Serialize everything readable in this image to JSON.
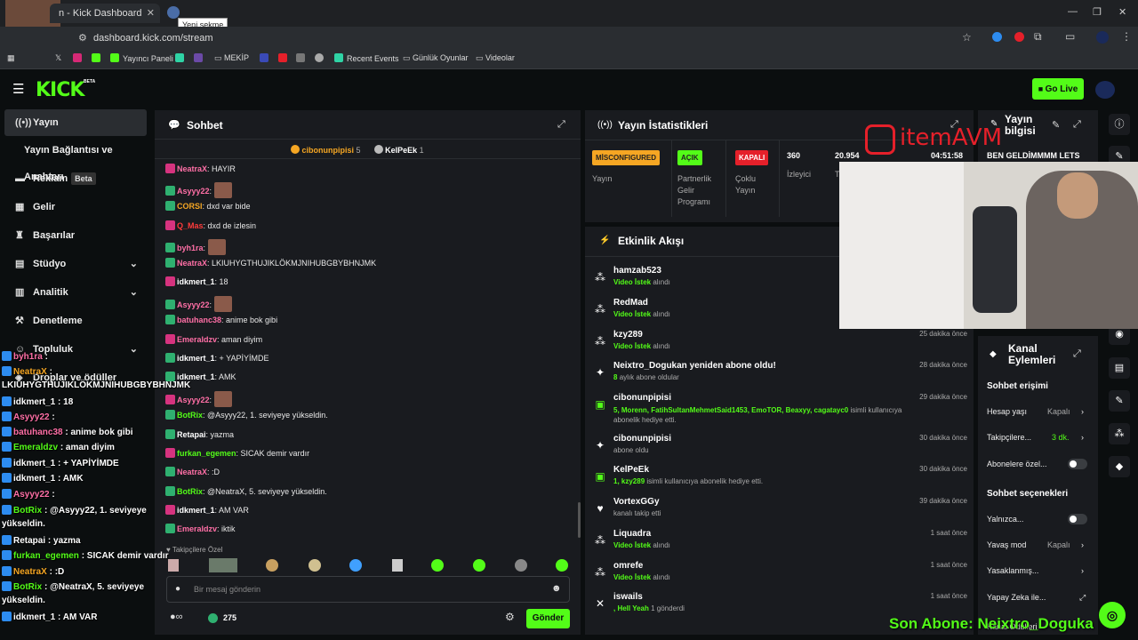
{
  "browser": {
    "tab_title": "n - Kick Dashboard",
    "tooltip": "Yeni sekme",
    "url": "dashboard.kick.com/stream",
    "bookmarks": [
      {
        "label": "Yayıncı Paneli",
        "color": "#53fc18"
      },
      {
        "label": "MEKİP",
        "color": "#888"
      },
      {
        "label": "Recent Events",
        "color": "#2fd3a5"
      },
      {
        "label": "Günlük Oyunlar",
        "color": "#888"
      },
      {
        "label": "Videolar",
        "color": "#888"
      }
    ]
  },
  "header": {
    "logo": "KICK",
    "logo_beta": "BETA",
    "go_live": "Go Live"
  },
  "sidebar": {
    "items": [
      {
        "label": "Yayın",
        "icon": "broadcast-icon"
      },
      {
        "label": "Yayın Bağlantısı ve Anahtarı"
      },
      {
        "label": "Reklam",
        "badge": "Beta",
        "icon": "ad-icon"
      },
      {
        "label": "Gelir",
        "icon": "revenue-icon"
      },
      {
        "label": "Başarılar",
        "icon": "trophy-icon"
      },
      {
        "label": "Stüdyo",
        "icon": "studio-icon"
      },
      {
        "label": "Analitik",
        "icon": "analytics-icon"
      },
      {
        "label": "Denetleme",
        "icon": "moderation-icon"
      },
      {
        "label": "Topluluk",
        "icon": "community-icon"
      },
      {
        "label": "Droplar ve ödüller",
        "icon": "drops-icon"
      }
    ]
  },
  "chat": {
    "title": "Sohbet",
    "top_gifters": [
      {
        "name": "cibonunpipisi",
        "count": "5"
      },
      {
        "name": "KelPeEk",
        "count": "1"
      }
    ],
    "messages": [
      {
        "user": "NeatraX",
        "color": "#ff6fa6",
        "text": "HAYIR"
      },
      {
        "user": "Asyyy22",
        "color": "#ff6fa6",
        "text": ""
      },
      {
        "user": "CORSI",
        "color": "#f5a623",
        "text": "dxd var bide"
      },
      {
        "user": "Q_Mas",
        "color": "#ff3b3b",
        "text": "dxd de izlesin"
      },
      {
        "user": "byh1ra",
        "color": "#ff6fa6",
        "text": ""
      },
      {
        "user": "NeatraX",
        "color": "#ff6fa6",
        "text": "LKIUHYGTHUJIKLÖKMJNIHUBGBYBHNJMK"
      },
      {
        "user": "idkmert_1",
        "color": "#ffffff",
        "text": "18"
      },
      {
        "user": "Asyyy22",
        "color": "#ff6fa6",
        "text": ""
      },
      {
        "user": "batuhanc38",
        "color": "#ff6fa6",
        "text": "anime bok gibi"
      },
      {
        "user": "Emeraldzv",
        "color": "#ff6fa6",
        "text": "aman diyim"
      },
      {
        "user": "idkmert_1",
        "color": "#ffffff",
        "text": "+ YAPİYİMDE"
      },
      {
        "user": "idkmert_1",
        "color": "#ffffff",
        "text": "AMK"
      },
      {
        "user": "Asyyy22",
        "color": "#ff6fa6",
        "text": ""
      },
      {
        "user": "BotRix",
        "color": "#53fc18",
        "text": "@Asyyy22, 1. seviyeye yükseldin."
      },
      {
        "user": "Retapai",
        "color": "#ffffff",
        "text": "yazma"
      },
      {
        "user": "furkan_egemen",
        "color": "#53fc18",
        "text": "SICAK demir vardır"
      },
      {
        "user": "NeatraX",
        "color": "#ff6fa6",
        "text": ":D"
      },
      {
        "user": "BotRix",
        "color": "#53fc18",
        "text": "@NeatraX, 5. seviyeye yükseldin."
      },
      {
        "user": "idkmert_1",
        "color": "#ffffff",
        "text": "AM VAR"
      },
      {
        "user": "Emeraldzv",
        "color": "#ff6fa6",
        "text": "iktik"
      }
    ],
    "followers_only": "Takipçilere Özel",
    "input_placeholder": "Bir mesaj gönderin",
    "points": "275",
    "send_label": "Gönder"
  },
  "stats": {
    "title": "Yayın İstatistikleri",
    "items": [
      {
        "pill": "MİSCONFIGURED",
        "pill_color": "#f5a623",
        "label": "Yayın"
      },
      {
        "pill": "AÇIK",
        "pill_color": "#53fc18",
        "label": "Partnerlik Gelir Programı"
      },
      {
        "pill": "KAPALI",
        "pill_color": "#e5202a",
        "label": "Çoklu Yayın"
      },
      {
        "value": "360",
        "label": "İzleyici"
      },
      {
        "value": "20.954",
        "label": "T"
      },
      {
        "value": "04:51:58",
        "label": ""
      }
    ]
  },
  "activity": {
    "title": "Etkinlik Akışı",
    "events": [
      {
        "name": "hamzab523",
        "sub_green": "Video İstek",
        "sub": "alındı",
        "time": "",
        "icon": "request-icon"
      },
      {
        "name": "RedMad",
        "sub_green": "Video İstek",
        "sub": "alındı",
        "time": "",
        "icon": "request-icon"
      },
      {
        "name": "kzy289",
        "sub_green": "Video İstek",
        "sub": "alındı",
        "time": "25 dakika önce",
        "icon": "request-icon"
      },
      {
        "name": "Neixtro_Dogukan yeniden abone oldu!",
        "sub_green": "8",
        "sub": "aylık abone oldular",
        "time": "28 dakika önce",
        "icon": "sparkle-icon"
      },
      {
        "name": "cibonunpipisi",
        "sub_green": "5, Morenn, FatihSultanMehmetSaid1453, EmoTOR, Beaxyy, cagatayc0",
        "sub": "isimli kullanıcıya abonelik hediye etti.",
        "time": "29 dakika önce",
        "icon": "gift-icon"
      },
      {
        "name": "cibonunpipisi",
        "sub_green": "",
        "sub": "abone oldu",
        "time": "30 dakika önce",
        "icon": "sparkle-icon"
      },
      {
        "name": "KelPeEk",
        "sub_green": "1, kzy289",
        "sub": "isimli kullanıcıya abonelik hediye etti.",
        "time": "30 dakika önce",
        "icon": "gift-icon"
      },
      {
        "name": "VortexGGy",
        "sub_green": "",
        "sub": "kanalı takip etti",
        "time": "39 dakika önce",
        "icon": "heart-icon"
      },
      {
        "name": "Liquadra",
        "sub_green": "Video İstek",
        "sub": "alındı",
        "time": "1 saat önce",
        "icon": "request-icon"
      },
      {
        "name": "omrefe",
        "sub_green": "Video İstek",
        "sub": "alındı",
        "time": "1 saat önce",
        "icon": "request-icon"
      },
      {
        "name": "iswails",
        "sub_green": ", Hell Yeah",
        "sub": "1 gönderdi",
        "time": "1 saat önce",
        "icon": "kick-icon"
      }
    ]
  },
  "stream_info": {
    "title": "Yayın bilgisi",
    "value": "BEN GELDİMMMM LETS"
  },
  "channel_actions": {
    "title": "Kanal Eylemleri",
    "chat_access": "Sohbet erişimi",
    "account_age": {
      "label": "Hesap yaşı",
      "value": "Kapalı"
    },
    "followers": {
      "label": "Takipçilere...",
      "value": "3 dk."
    },
    "subs_only": "Abonelere özel...",
    "chat_options": "Sohbet seçenekleri",
    "only": "Yalnızca...",
    "slow_mode": {
      "label": "Yavaş mod",
      "value": "Kapalı"
    },
    "banned": "Yasaklanmış...",
    "ai": "Yapay Zeka ile...",
    "channel_points": "Kanal Ödülleri"
  },
  "overlay": {
    "brand": "itemAVM",
    "last_sub": "Son Abone: Neixtro_Doguka",
    "left_chat": [
      {
        "user": "byh1ra",
        "color": "#ff6fa6",
        "text": ":"
      },
      {
        "user": "NeatraX",
        "color": "#f5a623",
        "text": ":"
      },
      {
        "user": "",
        "color": "#ffffff",
        "text": "LKIUHYGTHUJIKLÖKMJNIHUBGBYBHNJMK"
      },
      {
        "user": "idkmert_1",
        "color": "#ffffff",
        "text": ": 18"
      },
      {
        "user": "Asyyy22",
        "color": "#ff6fa6",
        "text": ":"
      },
      {
        "user": "batuhanc38",
        "color": "#ff6fa6",
        "text": ": anime bok gibi"
      },
      {
        "user": "Emeraldzv",
        "color": "#53fc18",
        "text": ": aman diyim"
      },
      {
        "user": "idkmert_1",
        "color": "#ffffff",
        "text": ": + YAPİYİMDE"
      },
      {
        "user": "idkmert_1",
        "color": "#ffffff",
        "text": ": AMK"
      },
      {
        "user": "Asyyy22",
        "color": "#ff6fa6",
        "text": ":"
      },
      {
        "user": "BotRix",
        "color": "#53fc18",
        "text": ": @Asyyy22, 1. seviyeye"
      },
      {
        "user": "",
        "color": "#ffffff",
        "text": "yükseldin."
      },
      {
        "user": "Retapai",
        "color": "#ffffff",
        "text": ": yazma"
      },
      {
        "user": "furkan_egemen",
        "color": "#53fc18",
        "text": ": SICAK demir vardır"
      },
      {
        "user": "NeatraX",
        "color": "#f5a623",
        "text": ": :D"
      },
      {
        "user": "BotRix",
        "color": "#53fc18",
        "text": ": @NeatraX, 5. seviyeye"
      },
      {
        "user": "",
        "color": "#ffffff",
        "text": "yükseldin."
      },
      {
        "user": "idkmert_1",
        "color": "#ffffff",
        "text": ": AM VAR"
      }
    ]
  }
}
